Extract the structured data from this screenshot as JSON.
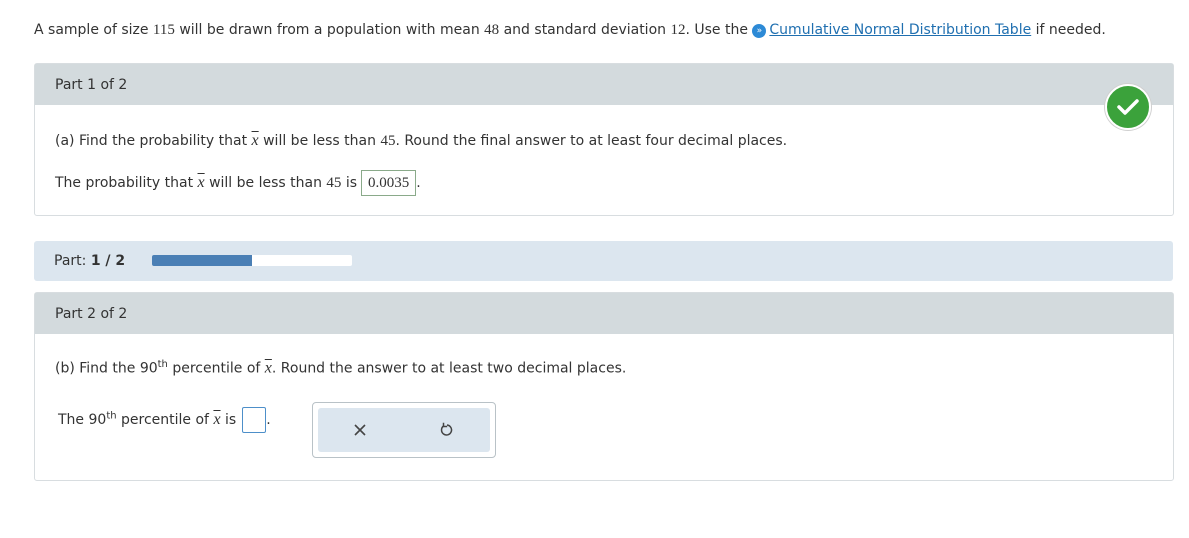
{
  "intro": {
    "prefix": "A sample of size ",
    "n": "115",
    "mid1": " will be drawn from a population with mean ",
    "mean": "48",
    "mid2": " and standard deviation ",
    "sd": "12",
    "mid3": ". Use the ",
    "link": "Cumulative Normal Distribution Table",
    "suffix": " if needed."
  },
  "part1": {
    "header": "Part 1 of 2",
    "q_prefix": "(a) Find the probability that ",
    "q_var": "x",
    "q_mid": " will be less than ",
    "q_value": "45",
    "q_suffix": ". Round the final answer to at least four decimal places.",
    "a_prefix": "The probability that ",
    "a_var": "x",
    "a_mid": " will be less than ",
    "a_value": "45",
    "a_is": " is",
    "answer": "0.0035",
    "a_end": ".",
    "status": "correct"
  },
  "progress": {
    "label": "Part: ",
    "current": "1 / 2",
    "fraction": 0.5,
    "color": "#4a7fb5"
  },
  "part2": {
    "header": "Part 2 of 2",
    "q_prefix": "(b) Find the 90",
    "q_sup": "th",
    "q_mid": " percentile of ",
    "q_var": "x",
    "q_suffix": ". Round the answer to at least two decimal places.",
    "a_prefix": "The 90",
    "a_sup": "th",
    "a_mid": " percentile of ",
    "a_var": "x",
    "a_is": " is",
    "answer": "",
    "a_end": "."
  },
  "tools": {
    "clear_icon": "close-icon",
    "undo_icon": "undo-icon"
  },
  "colors": {
    "check": "#3ba23b",
    "link": "#1f6fb0",
    "header_bg": "#d3dadd"
  }
}
